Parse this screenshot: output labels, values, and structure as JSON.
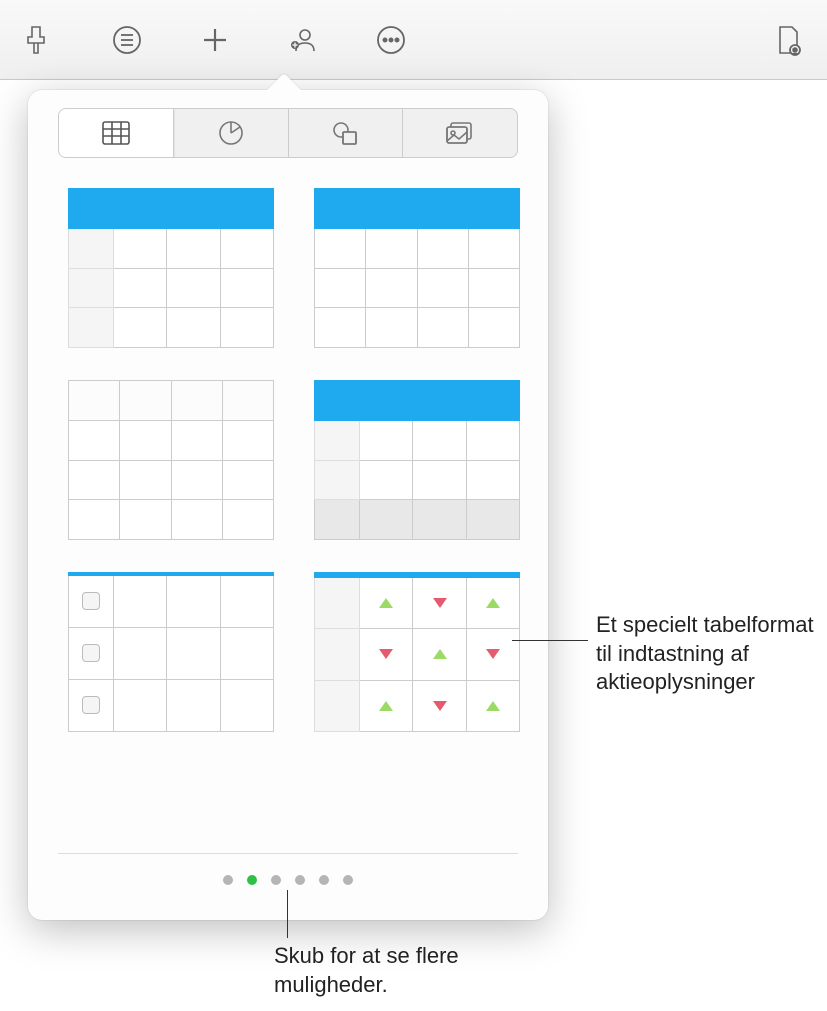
{
  "toolbar": {
    "icons": [
      "format-brush-icon",
      "list-icon",
      "plus-icon",
      "collaborate-icon",
      "more-icon",
      "document-icon"
    ]
  },
  "popover": {
    "tabs": [
      {
        "name": "tables-tab",
        "icon": "table-icon",
        "active": true
      },
      {
        "name": "charts-tab",
        "icon": "pie-chart-icon",
        "active": false
      },
      {
        "name": "shapes-tab",
        "icon": "shapes-icon",
        "active": false
      },
      {
        "name": "media-tab",
        "icon": "media-icon",
        "active": false
      }
    ],
    "table_styles": [
      {
        "name": "table-style-header-leftcol",
        "accent": "#1faaf0"
      },
      {
        "name": "table-style-header-plain",
        "accent": "#1faaf0"
      },
      {
        "name": "table-style-plain",
        "accent": "none"
      },
      {
        "name": "table-style-header-footer",
        "accent": "#1faaf0"
      },
      {
        "name": "table-style-checklist",
        "accent": "#1faaf0"
      },
      {
        "name": "table-style-stock",
        "accent": "#1faaf0"
      }
    ],
    "pages": {
      "count": 6,
      "active_index": 1
    }
  },
  "callouts": {
    "stock": "Et specielt tabelformat til indtastning af aktieoplysninger",
    "swipe": "Skub for at se flere muligheder."
  }
}
